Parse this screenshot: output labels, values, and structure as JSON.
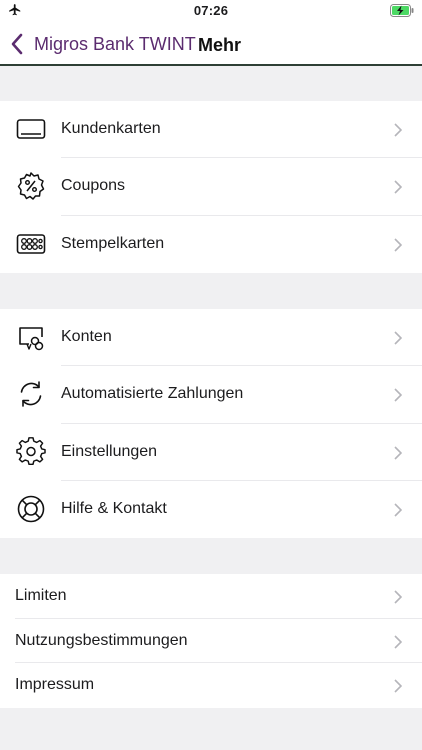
{
  "status": {
    "time": "07:26"
  },
  "nav": {
    "back_label": "Migros Bank TWINT",
    "title": "Mehr"
  },
  "section1": [
    {
      "label": "Kundenkarten",
      "icon": "card-icon"
    },
    {
      "label": "Coupons",
      "icon": "percent-badge-icon"
    },
    {
      "label": "Stempelkarten",
      "icon": "stamp-card-icon"
    }
  ],
  "section2": [
    {
      "label": "Konten",
      "icon": "accounts-icon"
    },
    {
      "label": "Automatisierte Zahlungen",
      "icon": "refresh-icon"
    },
    {
      "label": "Einstellungen",
      "icon": "gear-icon"
    },
    {
      "label": "Hilfe & Kontakt",
      "icon": "lifebuoy-icon"
    }
  ],
  "section3": [
    {
      "label": "Limiten"
    },
    {
      "label": "Nutzungsbestimmungen"
    },
    {
      "label": "Impressum"
    }
  ],
  "colors": {
    "accent": "#5b2c6f",
    "divider": "#2e3f35",
    "background": "#f0f0f2"
  }
}
